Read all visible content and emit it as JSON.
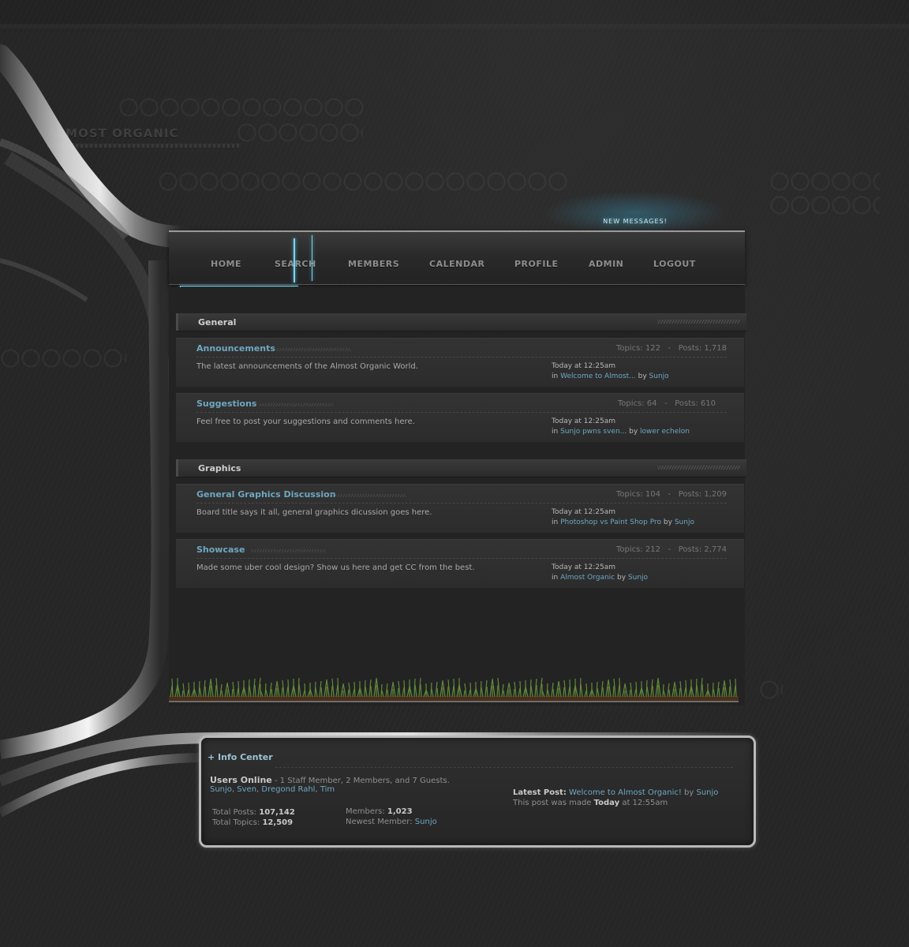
{
  "site": {
    "logo": "Almost organic"
  },
  "nav": {
    "new_messages": "NEW MESSAGES!",
    "items": [
      "HOME",
      "SEARCH",
      "MEMBERS",
      "CALENDAR",
      "PROFILE",
      "ADMIN",
      "LOGOUT"
    ]
  },
  "categories": [
    {
      "title": "General",
      "forums": [
        {
          "name": "Announcements",
          "topics": "Topics: 122",
          "posts": "Posts: 1,718",
          "description": "The latest announcements of the Almost Organic World.",
          "last_time": "Today at 12:25am",
          "last_in": "in",
          "last_thread": "Welcome to Almost...",
          "last_by": "by",
          "last_user": "Sunjo"
        },
        {
          "name": "Suggestions",
          "topics": "Topics: 64",
          "posts": "Posts: 610",
          "description": "Feel free to post your suggestions and comments here.",
          "last_time": "Today at 12:25am",
          "last_in": "in",
          "last_thread": "Sunjo pwns sven...",
          "last_by": "by",
          "last_user": "lower echelon"
        }
      ]
    },
    {
      "title": "Graphics",
      "forums": [
        {
          "name": "General Graphics Discussion",
          "topics": "Topics: 104",
          "posts": "Posts: 1,209",
          "description": "Board title says it all, general graphics dicussion goes here.",
          "last_time": "Today at 12:25am",
          "last_in": "in",
          "last_thread": "Photoshop vs Paint Shop Pro",
          "last_by": "by",
          "last_user": "Sunjo"
        },
        {
          "name": "Showcase",
          "topics": "Topics: 212",
          "posts": "Posts: 2,774",
          "description": "Made some uber cool design? Show us here and get CC from the best.",
          "last_time": "Today at 12:25am",
          "last_in": "in",
          "last_thread": "Almost Organic",
          "last_by": "by",
          "last_user": "Sunjo"
        }
      ]
    }
  ],
  "info_center": {
    "title": "+ Info Center",
    "users_online_label": "Users Online",
    "users_online_summary": "- 1 Staff Member, 2 Members, and 7 Guests.",
    "online_users": [
      "Sunjo",
      "Sven",
      "Dregond Rahl",
      "Tim"
    ],
    "total_posts_label": "Total Posts:",
    "total_posts": "107,142",
    "total_topics_label": "Total Topics:",
    "total_topics": "12,509",
    "members_label": "Members:",
    "members": "1,023",
    "newest_member_label": "Newest Member:",
    "newest_member": "Sunjo",
    "latest_post_label": "Latest Post:",
    "latest_post_title": "Welcome to Almost Organic!",
    "latest_post_by": "by",
    "latest_post_user": "Sunjo",
    "post_made_prefix": "This post was made",
    "post_made_day": "Today",
    "post_made_time": "at 12:55am"
  }
}
